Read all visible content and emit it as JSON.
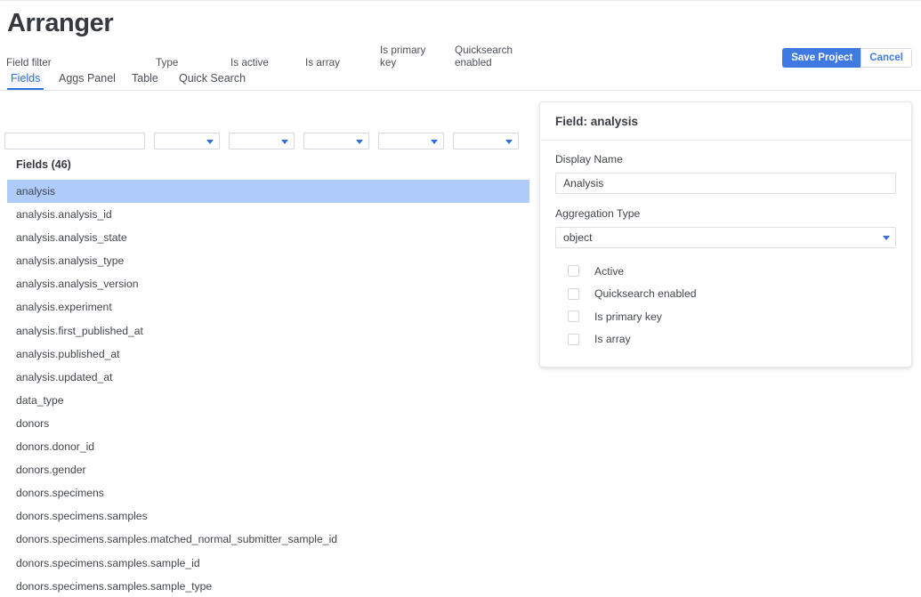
{
  "header": {
    "title": "Arranger",
    "save_label": "Save Project",
    "cancel_label": "Cancel"
  },
  "tabs": [
    {
      "label": "Fields",
      "active": true
    },
    {
      "label": "Aggs Panel",
      "active": false
    },
    {
      "label": "Table",
      "active": false
    },
    {
      "label": "Quick Search",
      "active": false
    }
  ],
  "filters": {
    "field_filter": {
      "label": "Field filter",
      "value": "",
      "placeholder": ""
    },
    "type": {
      "label": "Type",
      "value": ""
    },
    "is_active": {
      "label": "Is active",
      "value": ""
    },
    "is_array": {
      "label": "Is array",
      "value": ""
    },
    "is_primary_key": {
      "label": "Is primary\nkey",
      "value": ""
    },
    "quicksearch_enabled": {
      "label": "Quicksearch\nenabled",
      "value": ""
    }
  },
  "fields_section": {
    "header": "Fields (46)",
    "count": 46,
    "selected": "analysis",
    "items": [
      "analysis",
      "analysis.analysis_id",
      "analysis.analysis_state",
      "analysis.analysis_type",
      "analysis.analysis_version",
      "analysis.experiment",
      "analysis.first_published_at",
      "analysis.published_at",
      "analysis.updated_at",
      "data_type",
      "donors",
      "donors.donor_id",
      "donors.gender",
      "donors.specimens",
      "donors.specimens.samples",
      "donors.specimens.samples.matched_normal_submitter_sample_id",
      "donors.specimens.samples.sample_id",
      "donors.specimens.samples.sample_type"
    ]
  },
  "detail_panel": {
    "title": "Field: analysis",
    "display_name": {
      "label": "Display Name",
      "value": "Analysis"
    },
    "aggregation_type": {
      "label": "Aggregation Type",
      "value": "object"
    },
    "checkboxes": [
      {
        "label": "Active",
        "checked": false
      },
      {
        "label": "Quicksearch enabled",
        "checked": false
      },
      {
        "label": "Is primary key",
        "checked": false
      },
      {
        "label": "Is array",
        "checked": false
      }
    ]
  },
  "colors": {
    "accent": "#3f7ae4",
    "selected_row": "#aecbfa",
    "tab_active": "#2f6fe0"
  }
}
